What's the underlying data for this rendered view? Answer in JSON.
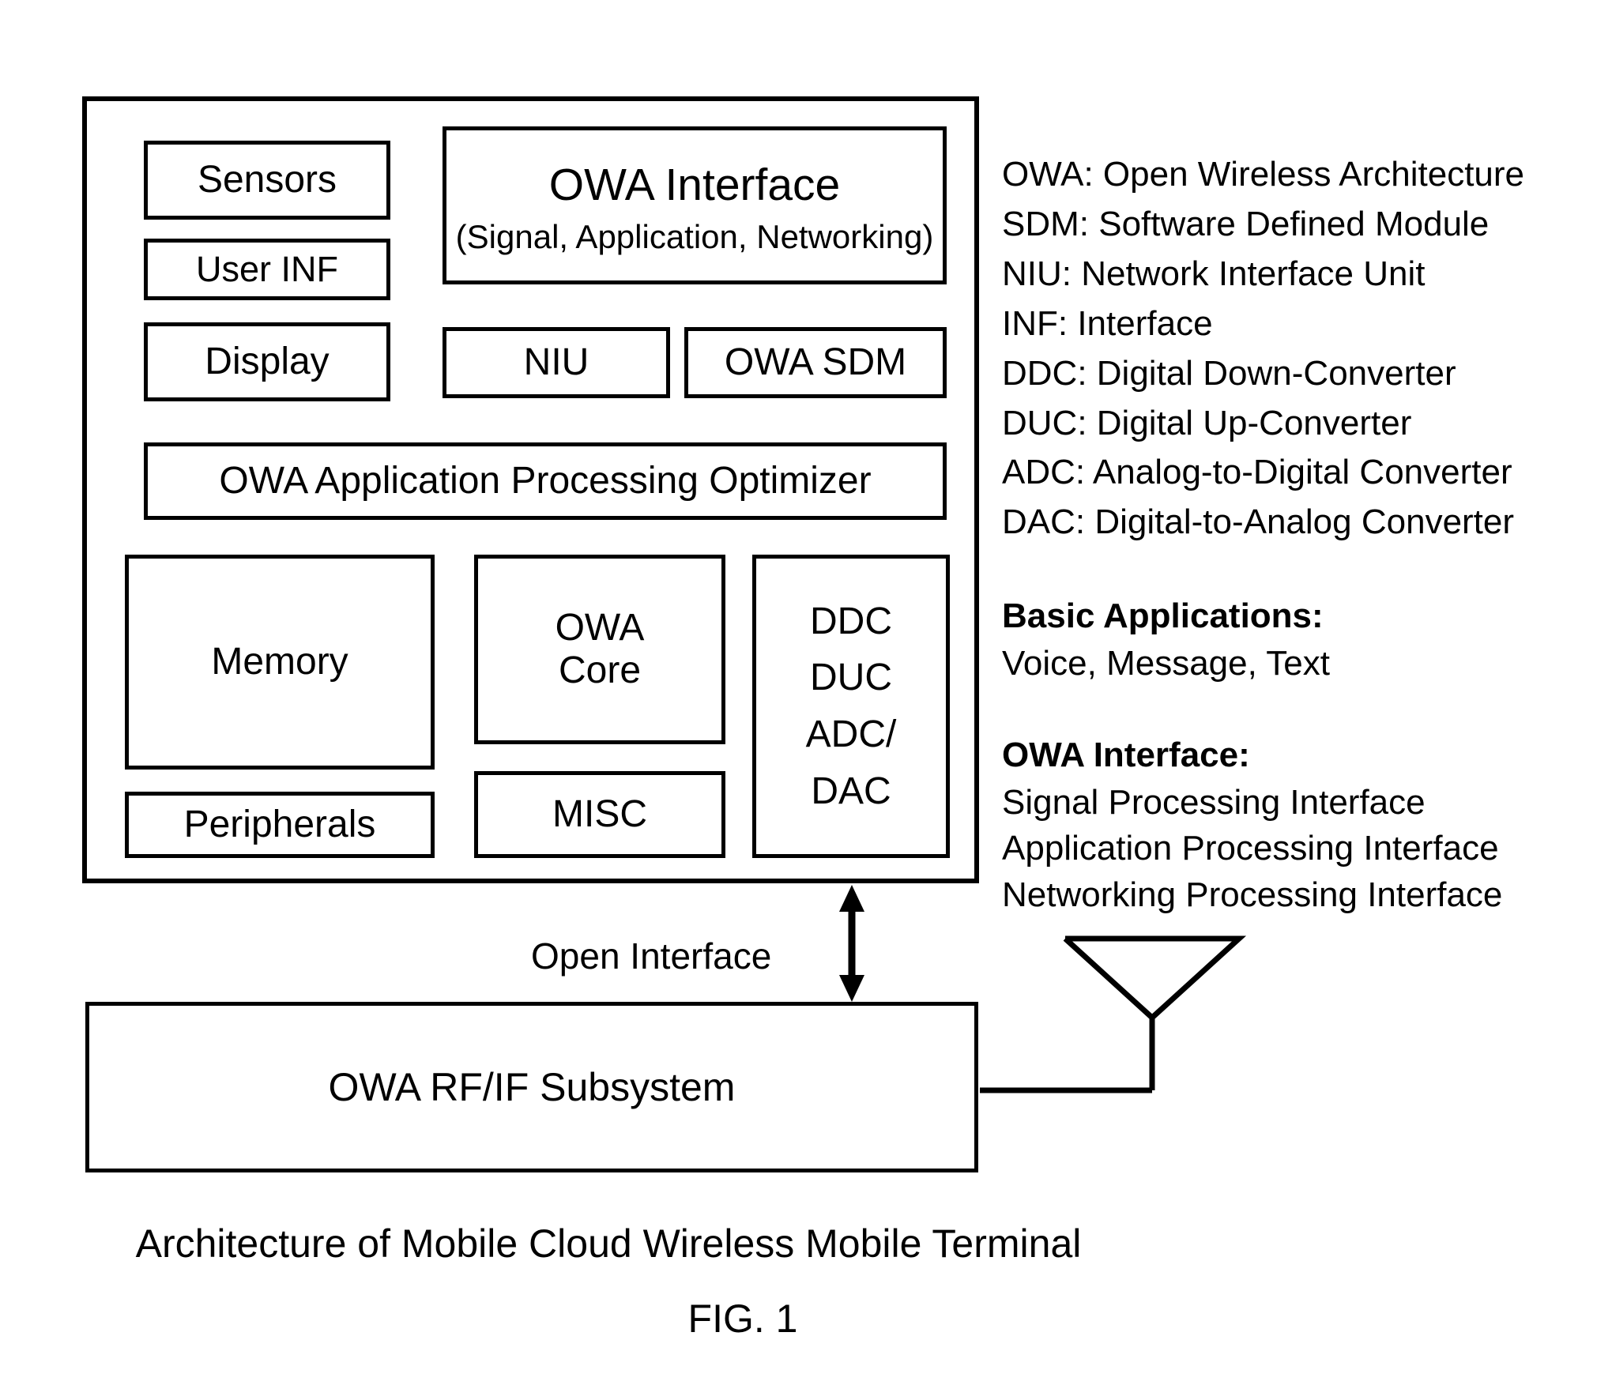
{
  "diagram": {
    "terminal": {
      "sensors": "Sensors",
      "user_inf": "User INF",
      "display": "Display",
      "owa_interface_title": "OWA Interface",
      "owa_interface_sub": "(Signal, Application, Networking)",
      "niu": "NIU",
      "owa_sdm": "OWA SDM",
      "optimizer": "OWA Application Processing Optimizer",
      "memory": "Memory",
      "peripherals": "Peripherals",
      "owa_core_line1": "OWA",
      "owa_core_line2": "Core",
      "misc": "MISC",
      "converters": [
        "DDC",
        "DUC",
        "ADC/",
        "DAC"
      ]
    },
    "open_interface_label": "Open Interface",
    "rf_if_subsystem": "OWA RF/IF Subsystem",
    "caption": "Architecture of Mobile Cloud Wireless Mobile Terminal",
    "figure_number": "FIG. 1"
  },
  "legend": {
    "abbreviations": [
      "OWA: Open Wireless Architecture",
      "SDM: Software Defined Module",
      "NIU: Network Interface Unit",
      "INF: Interface",
      "DDC: Digital Down-Converter",
      "DUC: Digital Up-Converter",
      "ADC: Analog-to-Digital Converter",
      "DAC: Digital-to-Analog Converter"
    ],
    "basic_applications": {
      "title": "Basic Applications:",
      "lines": [
        "Voice, Message, Text"
      ]
    },
    "owa_interface": {
      "title": "OWA Interface:",
      "lines": [
        "Signal Processing Interface",
        "Application Processing Interface",
        "Networking Processing Interface"
      ]
    }
  },
  "colors": {
    "stroke": "#000000",
    "background": "#ffffff"
  }
}
